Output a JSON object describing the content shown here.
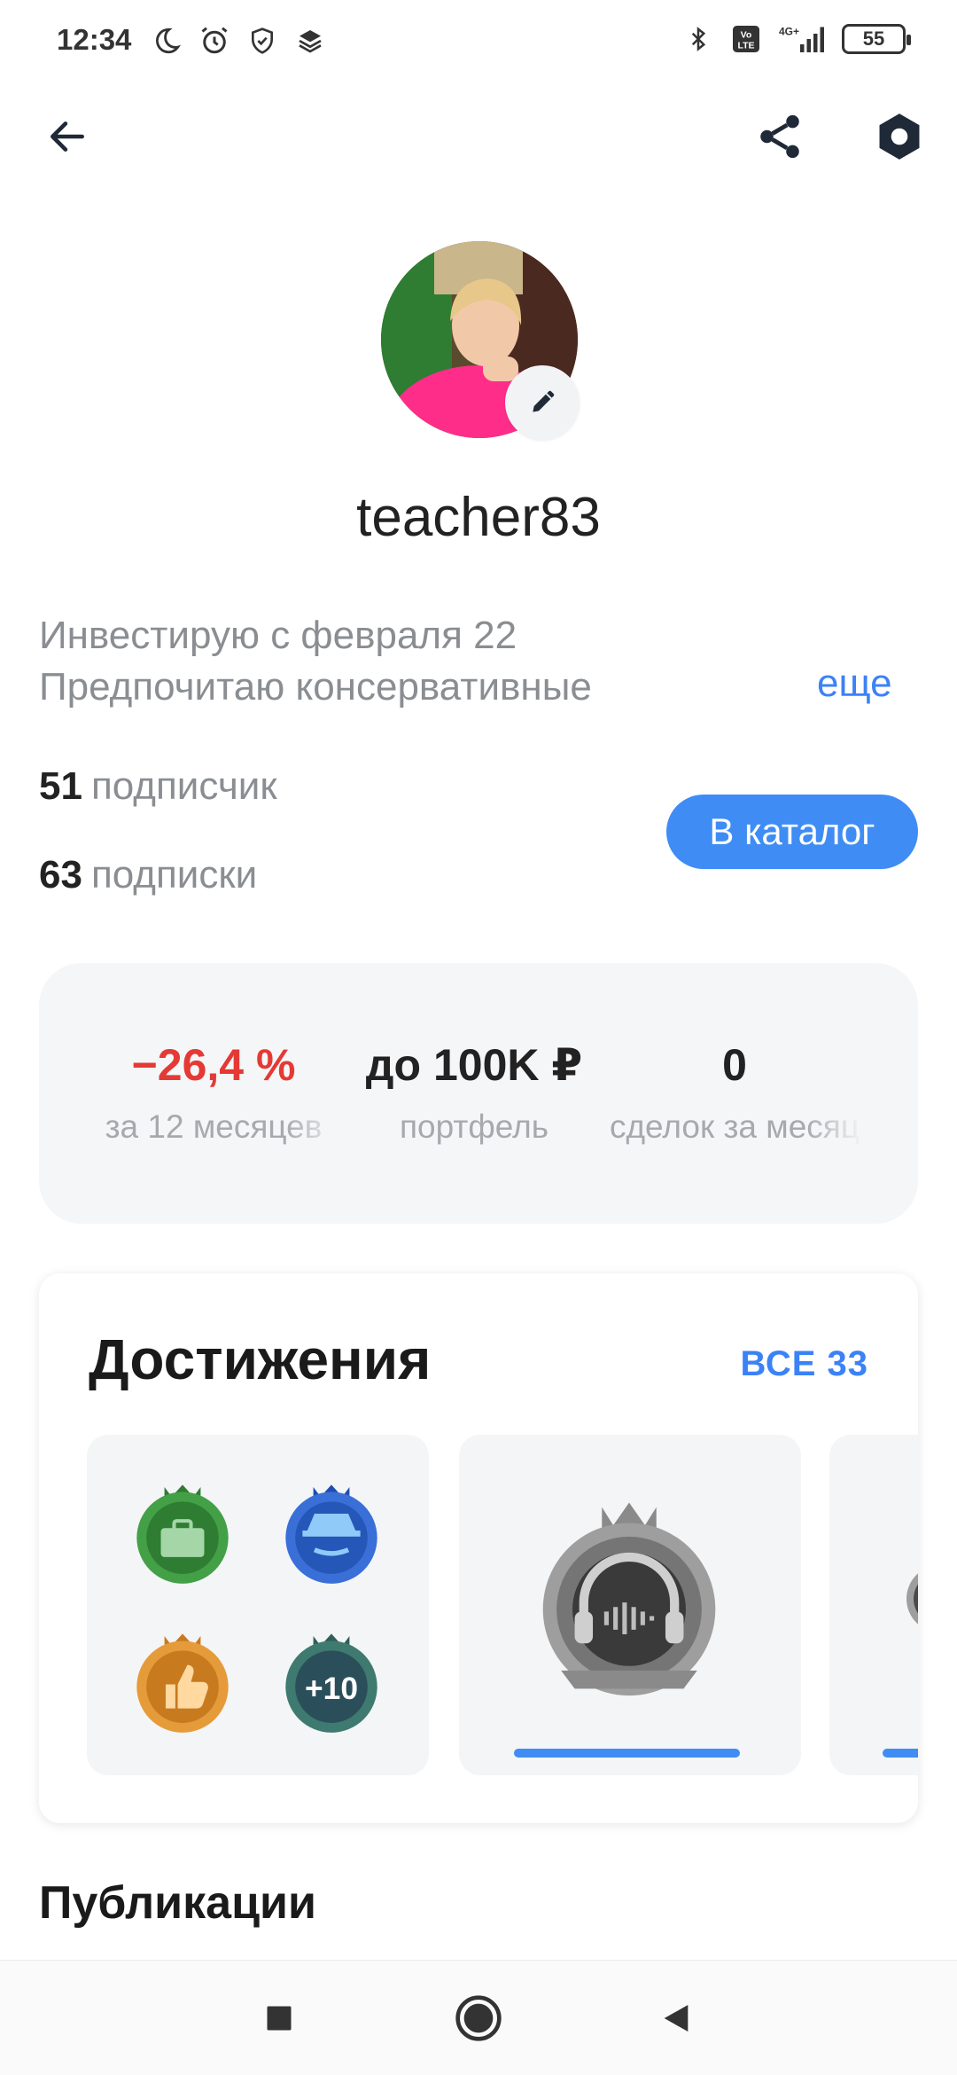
{
  "status_bar": {
    "time": "12:34",
    "network": "4G+",
    "battery": "55",
    "left_icons": [
      "moon-icon",
      "alarm-icon",
      "shield-icon",
      "layers-icon"
    ],
    "right_icons": [
      "bluetooth-icon",
      "volte-icon",
      "signal-icon"
    ]
  },
  "toolbar": {
    "icons": [
      "back-arrow-icon",
      "share-icon",
      "settings-hexagon-icon"
    ]
  },
  "profile": {
    "username": "teacher83",
    "bio_line1": "Инвестирую с февраля 22",
    "bio_line2": "Предпочитаю консервативные",
    "bio_more": "еще",
    "followers_count": "51",
    "followers_label": "подписчик",
    "following_count": "63",
    "following_label": "подписки",
    "catalog_button": "В каталог"
  },
  "stats": [
    {
      "value": "−26,4 %",
      "label": "за 12 месяцев",
      "negative": true
    },
    {
      "value": "до 100K ₽",
      "label": "портфель",
      "negative": false
    },
    {
      "value": "0",
      "label": "сделок за месяц",
      "negative": false
    }
  ],
  "achievements": {
    "title": "Достижения",
    "all_label": "ВСЕ 33",
    "more_badge_label": "+10",
    "badges": [
      "briefcase-badge-icon",
      "detective-badge-icon",
      "thumbs-up-badge-icon",
      "more-badges-icon",
      "headphones-badge-icon"
    ],
    "progress": [
      0.98,
      0.5
    ]
  },
  "publications_title": "Публикации",
  "colors": {
    "accent": "#3f8cf5",
    "negative": "#e53935",
    "muted": "#8a8d91"
  },
  "nav_bar": {
    "icons": [
      "recent-apps-icon",
      "home-icon",
      "back-triangle-icon"
    ]
  }
}
